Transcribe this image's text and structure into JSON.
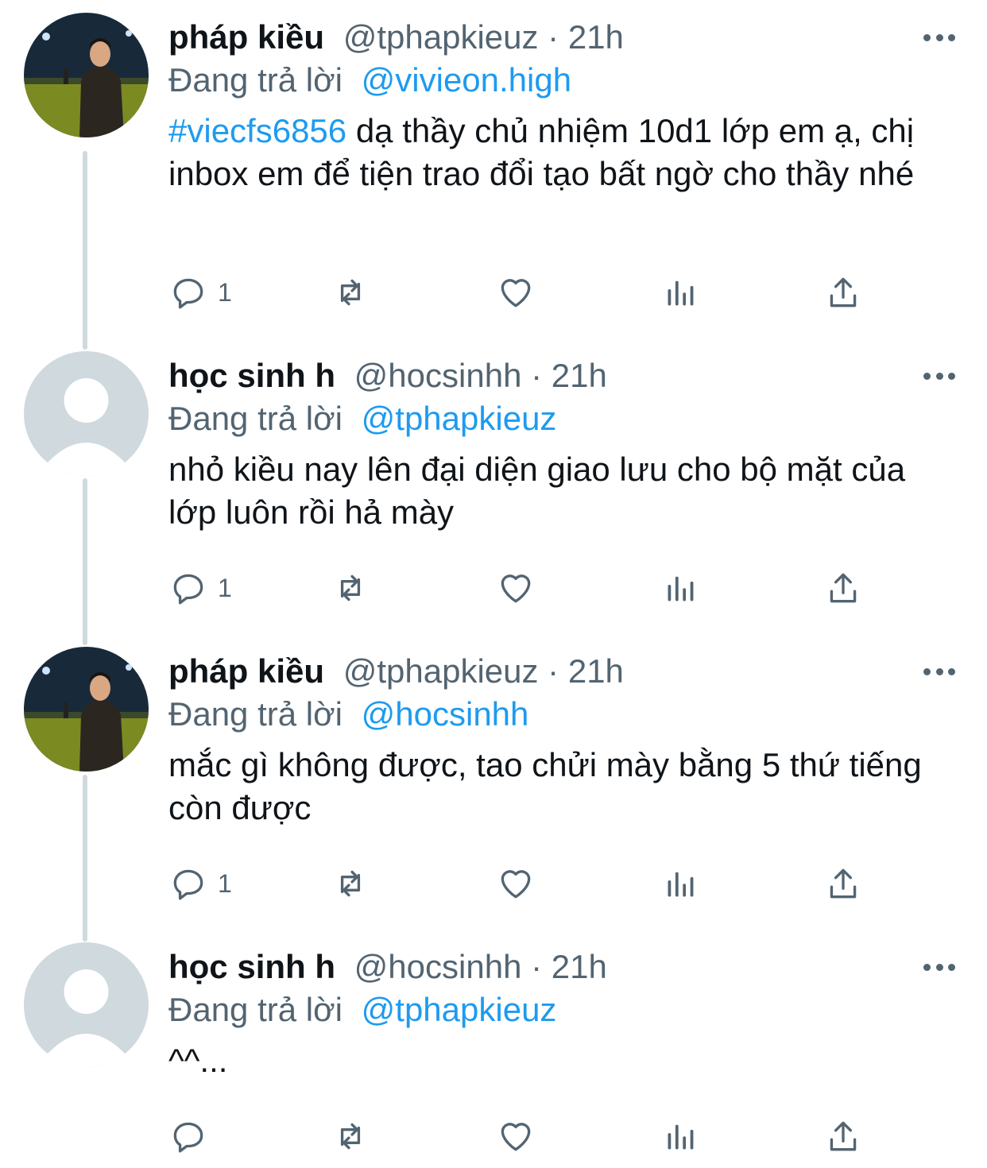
{
  "colors": {
    "link": "#1d9bf0",
    "muted": "#536471",
    "text": "#0f1419",
    "thread_line": "#cfd9de",
    "default_avatar_bg": "#cfd9de"
  },
  "replying_label": "Đang trả lời",
  "tweets": [
    {
      "avatar": "profile-photo",
      "name": "pháp kiều",
      "meta": "@tphapkieuz · 21h",
      "reply_to": "@vivieon.high",
      "hashtag": "#viecfs6856",
      "text": " dạ thầy chủ nhiệm 10d1 lớp em ạ, chị inbox em để tiện trao đổi tạo bất ngờ cho thầy nhé",
      "reply_count": "1"
    },
    {
      "avatar": "default-avatar",
      "name": "học sinh h",
      "meta": "@hocsinhh · 21h",
      "reply_to": "@tphapkieuz",
      "hashtag": "",
      "text": "nhỏ kiều nay lên đại diện giao lưu cho bộ mặt của lớp luôn rồi hả mày",
      "reply_count": "1"
    },
    {
      "avatar": "profile-photo",
      "name": "pháp kiều",
      "meta": "@tphapkieuz · 21h",
      "reply_to": "@hocsinhh",
      "hashtag": "",
      "text": "mắc gì không được, tao chửi mày bằng 5 thứ tiếng còn được",
      "reply_count": "1"
    },
    {
      "avatar": "default-avatar",
      "name": "học sinh h",
      "meta": "@hocsinhh · 21h",
      "reply_to": "@tphapkieuz",
      "hashtag": "",
      "text": "^^...",
      "reply_count": ""
    }
  ]
}
